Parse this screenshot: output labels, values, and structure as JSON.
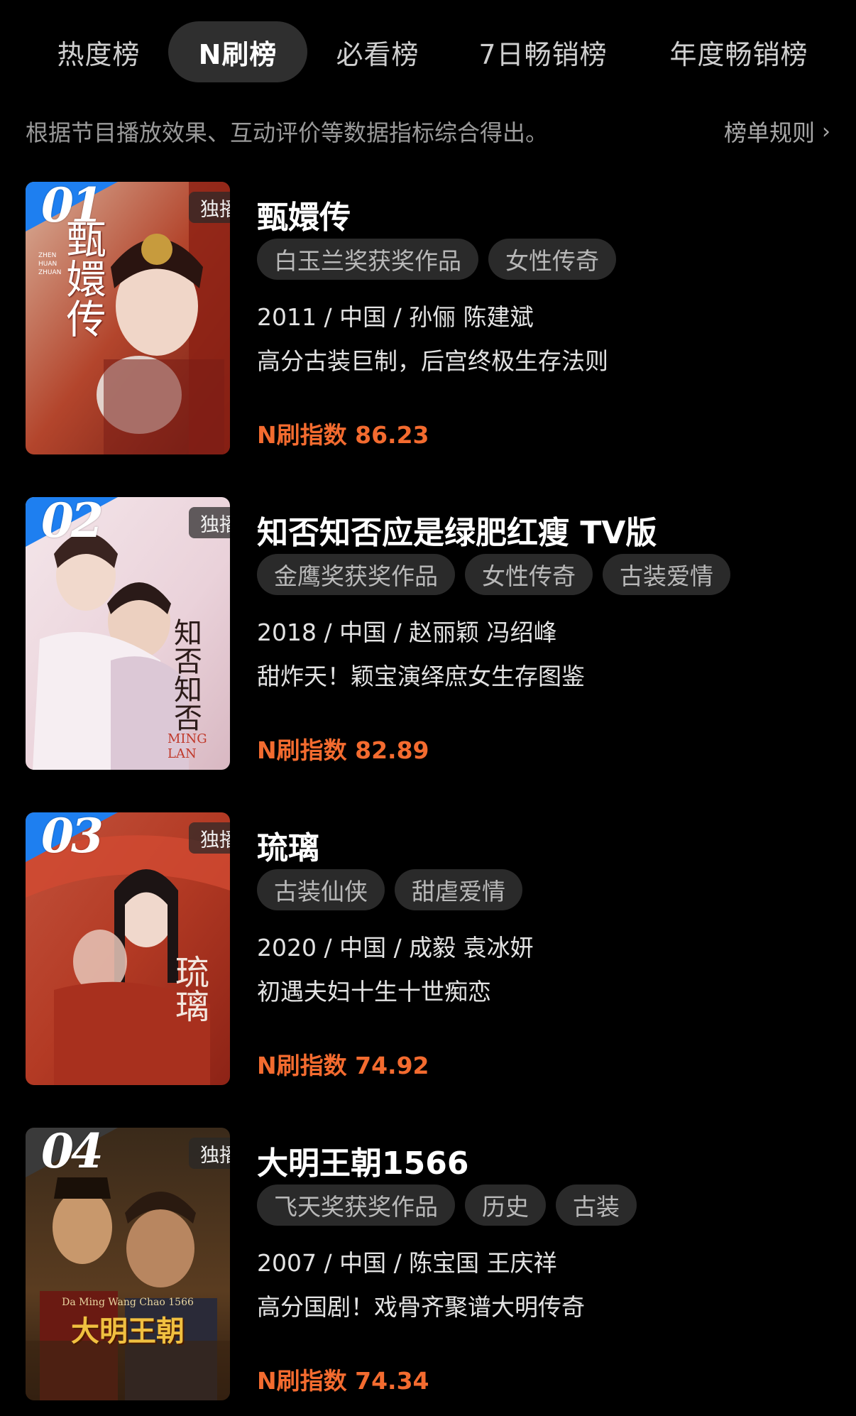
{
  "tabs": [
    {
      "label": "热度榜",
      "active": false
    },
    {
      "label": "N刷榜",
      "active": true
    },
    {
      "label": "必看榜",
      "active": false
    },
    {
      "label": "7日畅销榜",
      "active": false
    },
    {
      "label": "年度畅销榜",
      "active": false
    }
  ],
  "subtitle": "根据节目播放效果、互动评价等数据指标综合得出。",
  "rules_link": "榜单规则",
  "badge_label": "独播",
  "score_prefix": "N刷指数",
  "items": [
    {
      "rank": "01",
      "title": "甄嬛传",
      "tags": [
        "白玉兰奖获奖作品",
        "女性传奇"
      ],
      "meta": "2011 / 中国 / 孙俪 陈建斌",
      "desc": "高分古装巨制，后宫终极生存法则",
      "score": "86.23",
      "poster_text": "甄嬛传",
      "poster_sub": "ZHEN HUAN ZHUAN"
    },
    {
      "rank": "02",
      "title": "知否知否应是绿肥红瘦 TV版",
      "tags": [
        "金鹰奖获奖作品",
        "女性传奇",
        "古装爱情"
      ],
      "meta": "2018 / 中国 / 赵丽颖 冯绍峰",
      "desc": "甜炸天！颖宝演绎庶女生存图鉴",
      "score": "82.89",
      "poster_text": "知否知否",
      "poster_sub": "MING LAN"
    },
    {
      "rank": "03",
      "title": "琉璃",
      "tags": [
        "古装仙侠",
        "甜虐爱情"
      ],
      "meta": "2020 / 中国 / 成毅 袁冰妍",
      "desc": "初遇夫妇十生十世痴恋",
      "score": "74.92",
      "poster_text": "琉璃",
      "poster_sub": ""
    },
    {
      "rank": "04",
      "title": "大明王朝1566",
      "tags": [
        "飞天奖获奖作品",
        "历史",
        "古装"
      ],
      "meta": "2007 / 中国 / 陈宝国 王庆祥",
      "desc": "高分国剧！戏骨齐聚谱大明传奇",
      "score": "74.34",
      "poster_text": "大明王朝",
      "poster_sub": "Da Ming Wang Chao 1566"
    }
  ],
  "colors": {
    "accent_orange": "#f36b2f",
    "rank_blue": "#1e7ff0",
    "tab_active_bg": "#2f2f2f",
    "tag_bg": "#2a2a2a"
  }
}
